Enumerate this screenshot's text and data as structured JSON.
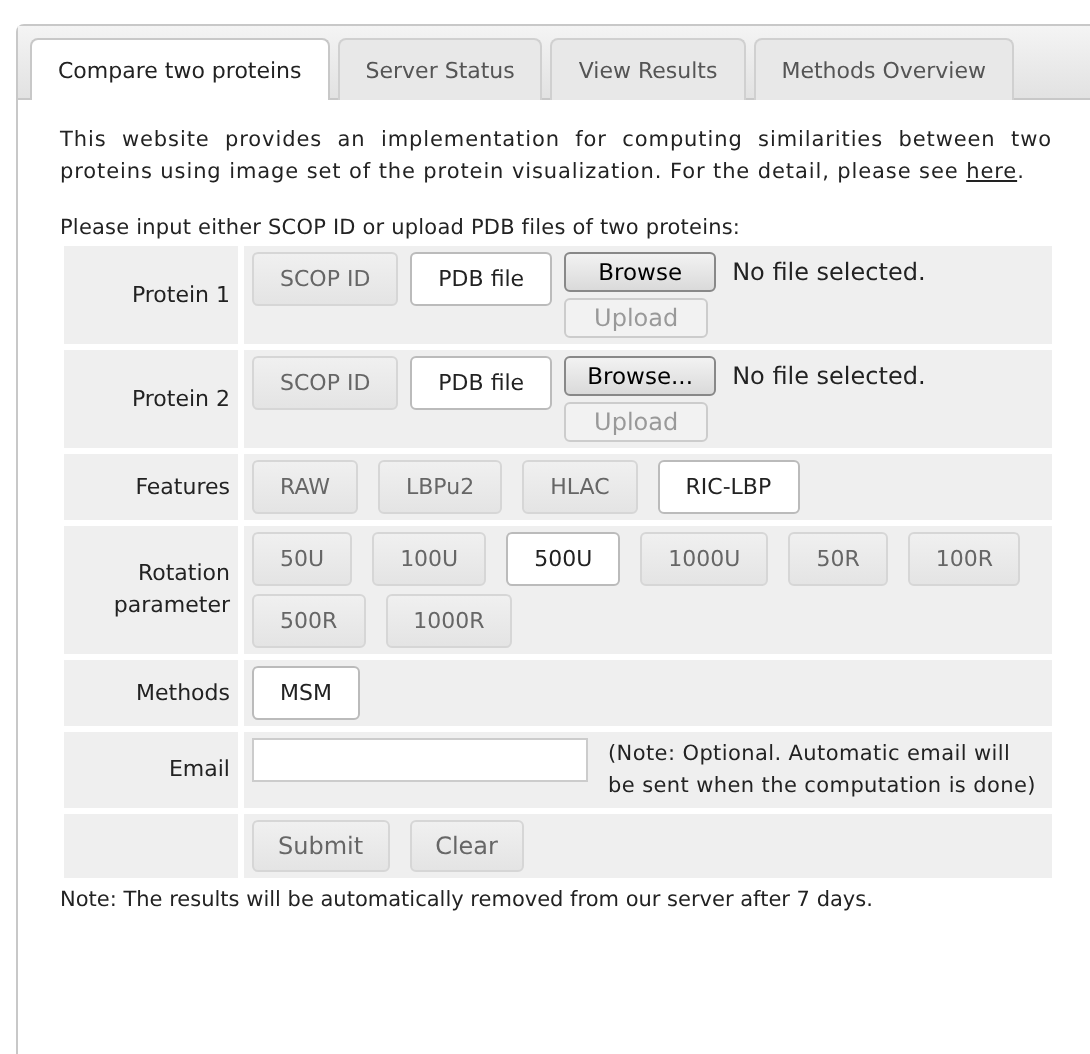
{
  "tabs": [
    {
      "label": "Compare two proteins",
      "selected": true
    },
    {
      "label": "Server Status",
      "selected": false
    },
    {
      "label": "View Results",
      "selected": false
    },
    {
      "label": "Methods Overview",
      "selected": false
    }
  ],
  "intro": {
    "text": "This website provides an implementation for computing similarities between two proteins using image set of the protein visualization. For the detail, please see",
    "link": "here",
    "end": "."
  },
  "instruction": "Please input either SCOP ID or upload PDB files of two proteins:",
  "rows": [
    {
      "kind": "protein",
      "label": "Protein 1",
      "options": [
        {
          "label": "SCOP ID",
          "selected": false
        },
        {
          "label": "PDB file",
          "selected": true
        }
      ],
      "browse": "Browse",
      "file_status": "No file selected.",
      "upload": "Upload"
    },
    {
      "kind": "protein",
      "label": "Protein 2",
      "options": [
        {
          "label": "SCOP ID",
          "selected": false
        },
        {
          "label": "PDB file",
          "selected": true
        }
      ],
      "browse": "Browse...",
      "file_status": "No file selected.",
      "upload": "Upload"
    },
    {
      "kind": "choice",
      "label": "Features",
      "options": [
        {
          "label": "RAW",
          "selected": false
        },
        {
          "label": "LBPu2",
          "selected": false
        },
        {
          "label": "HLAC",
          "selected": false
        },
        {
          "label": "RIC-LBP",
          "selected": true
        }
      ]
    },
    {
      "kind": "choice",
      "label": "Rotation parameter",
      "options": [
        {
          "label": "50U",
          "selected": false
        },
        {
          "label": "100U",
          "selected": false
        },
        {
          "label": "500U",
          "selected": true
        },
        {
          "label": "1000U",
          "selected": false
        },
        {
          "label": "50R",
          "selected": false
        },
        {
          "label": "100R",
          "selected": false
        },
        {
          "label": "500R",
          "selected": false
        },
        {
          "label": "1000R",
          "selected": false
        }
      ]
    },
    {
      "kind": "choice",
      "label": "Methods",
      "options": [
        {
          "label": "MSM",
          "selected": true
        }
      ]
    },
    {
      "kind": "email",
      "label": "Email",
      "note": "(Note: Optional. Automatic email will be sent when the computation is done)"
    },
    {
      "kind": "actions",
      "buttons": [
        "Submit",
        "Clear"
      ]
    }
  ],
  "footer_note": "Note: The results will be automatically removed from our server after 7 days."
}
